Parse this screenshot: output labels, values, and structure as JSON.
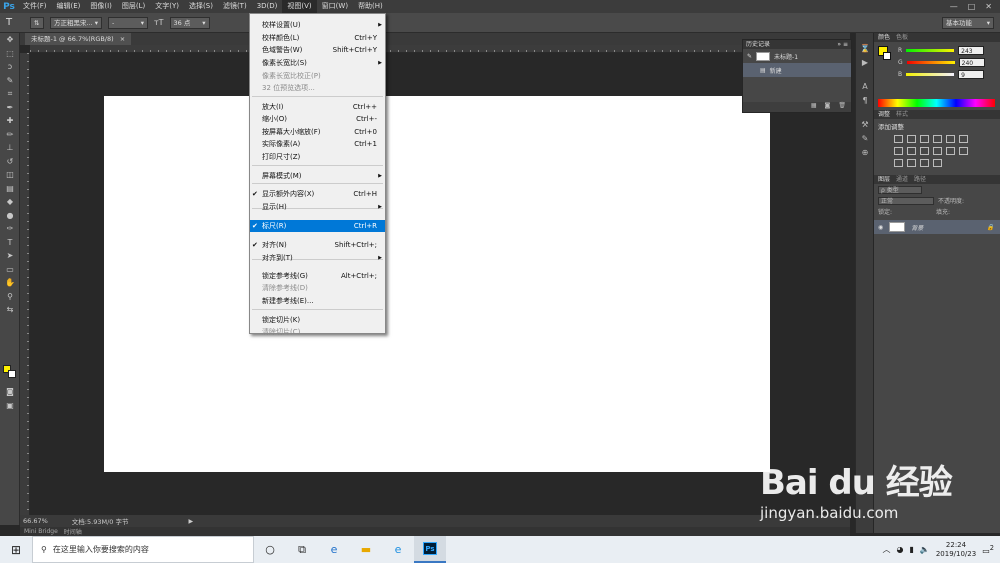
{
  "app": {
    "logo": "Ps"
  },
  "menubar": {
    "items": [
      "文件(F)",
      "编辑(E)",
      "图像(I)",
      "图层(L)",
      "文字(Y)",
      "选择(S)",
      "滤镜(T)",
      "3D(D)",
      "视图(V)",
      "窗口(W)",
      "帮助(H)"
    ],
    "window_controls": [
      "—",
      "□",
      "✕"
    ]
  },
  "options": {
    "tool_icon": "T",
    "font_family": "方正粗黑宋...",
    "font_style": "-",
    "font_size": "36 点",
    "workspace": "基本功能"
  },
  "document": {
    "tab_title": "未标题-1 @ 66.7%(RGB/8)",
    "tab_close": "×",
    "zoom": "66.67%",
    "doc_info": "文档:5.93M/0 字节",
    "status_arrow": "▶"
  },
  "bottom_tabs": [
    "Mini Bridge",
    "时间轴"
  ],
  "history_panel": {
    "title": "历史记录",
    "controls": "»  ≡",
    "snapshot": "未标题-1",
    "step": "新建",
    "footer_icons": [
      "▦",
      "◙",
      "🗑"
    ]
  },
  "color_panel": {
    "tabs": [
      "颜色",
      "色板"
    ],
    "fg_color": "#fff100",
    "channels": [
      {
        "label": "R",
        "value": "243",
        "color": "#f3f300"
      },
      {
        "label": "G",
        "value": "240",
        "color": "#f0f000"
      },
      {
        "label": "B",
        "value": "9",
        "color": "#e0e000"
      }
    ]
  },
  "adjust_panel": {
    "tabs": [
      "调整",
      "样式"
    ],
    "title": "添加调整"
  },
  "layers_panel": {
    "tabs": [
      "图层",
      "通道",
      "路径"
    ],
    "kind_label": "ρ 类型",
    "blend_mode": "正常",
    "opacity_label": "不透明度:",
    "lock_label": "锁定:",
    "fill_label": "填充:",
    "layer_name": "背景",
    "lock_icon": "🔒",
    "eye_icon": "◉"
  },
  "view_menu": {
    "items": [
      {
        "label": "校样设置(U)",
        "shortcut": "",
        "disabled": false,
        "submenu": true
      },
      {
        "label": "校样颜色(L)",
        "shortcut": "Ctrl+Y",
        "disabled": false
      },
      {
        "label": "色域警告(W)",
        "shortcut": "Shift+Ctrl+Y",
        "disabled": false
      },
      {
        "label": "像素长宽比(S)",
        "shortcut": "",
        "disabled": false,
        "submenu": true
      },
      {
        "label": "像素长宽比校正(P)",
        "shortcut": "",
        "disabled": true
      },
      {
        "label": "32 位预览选项...",
        "shortcut": "",
        "disabled": true
      },
      {
        "label": "放大(I)",
        "shortcut": "Ctrl++",
        "disabled": false
      },
      {
        "label": "缩小(O)",
        "shortcut": "Ctrl+-",
        "disabled": false
      },
      {
        "label": "按屏幕大小缩放(F)",
        "shortcut": "Ctrl+0",
        "disabled": false
      },
      {
        "label": "实际像素(A)",
        "shortcut": "Ctrl+1",
        "disabled": false
      },
      {
        "label": "打印尺寸(Z)",
        "shortcut": "",
        "disabled": false
      },
      {
        "label": "屏幕模式(M)",
        "shortcut": "",
        "disabled": false,
        "submenu": true
      },
      {
        "label": "显示额外内容(X)",
        "shortcut": "Ctrl+H",
        "disabled": false,
        "checked": true
      },
      {
        "label": "显示(H)",
        "shortcut": "",
        "disabled": false,
        "submenu": true
      },
      {
        "label": "标尺(R)",
        "shortcut": "Ctrl+R",
        "disabled": false,
        "checked": true,
        "highlighted": true
      },
      {
        "label": "对齐(N)",
        "shortcut": "Shift+Ctrl+;",
        "disabled": false,
        "checked": true
      },
      {
        "label": "对齐到(T)",
        "shortcut": "",
        "disabled": false,
        "submenu": true
      },
      {
        "label": "锁定参考线(G)",
        "shortcut": "Alt+Ctrl+;",
        "disabled": false
      },
      {
        "label": "清除参考线(D)",
        "shortcut": "",
        "disabled": true
      },
      {
        "label": "新建参考线(E)...",
        "shortcut": "",
        "disabled": false
      },
      {
        "label": "锁定切片(K)",
        "shortcut": "",
        "disabled": false
      },
      {
        "label": "清除切片(C)",
        "shortcut": "",
        "disabled": true
      }
    ]
  },
  "watermark": {
    "brand": "Bai du 经验",
    "url": "jingyan.baidu.com"
  },
  "taskbar": {
    "start_icon": "⊞",
    "search_icon": "⚲",
    "search_placeholder": "在这里输入你要搜索的内容",
    "time": "22:24",
    "date": "2019/10/23",
    "notification_count": "2"
  }
}
